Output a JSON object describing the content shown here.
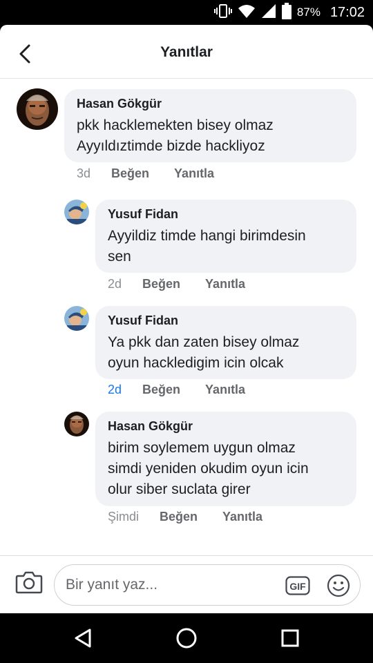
{
  "status_bar": {
    "battery_percent": "87%",
    "time": "17:02",
    "icons": [
      "vibrate-icon",
      "wifi-icon",
      "signal-icon",
      "battery-icon"
    ]
  },
  "header": {
    "title": "Yanıtlar",
    "back_icon": "back-arrow-icon"
  },
  "comments": [
    {
      "author": "Hasan Gökgür",
      "lines": [
        "pkk hacklemekten bisey olmaz",
        "Ayyıldıztimde bizde hackliyoz"
      ],
      "time": "3d",
      "like": "Beğen",
      "reply": "Yanıtla"
    },
    {
      "author": "Yusuf Fidan",
      "lines": [
        "Ayyildiz timde hangi birimdesin",
        "sen"
      ],
      "time": "2d",
      "like": "Beğen",
      "reply": "Yanıtla"
    },
    {
      "author": "Yusuf Fidan",
      "lines": [
        "Ya pkk dan zaten bisey olmaz",
        "oyun hackledigim icin olcak"
      ],
      "time": "2d",
      "like": "Beğen",
      "reply": "Yanıtla"
    },
    {
      "author": "Hasan Gökgür",
      "lines": [
        "birim soylemem uygun olmaz",
        "simdi yeniden okudim oyun icin",
        "olur siber suclata girer"
      ],
      "time": "Şimdi",
      "like": "Beğen",
      "reply": "Yanıtla"
    }
  ],
  "composer": {
    "placeholder": "Bir yanıt yaz...",
    "gif_label": "GIF",
    "icons": [
      "camera-icon",
      "gif-icon",
      "emoji-icon"
    ]
  },
  "nav_bar": {
    "icons": [
      "back-triangle-icon",
      "home-circle-icon",
      "recents-square-icon"
    ]
  },
  "colors": {
    "bubble": "#f0f2f5",
    "text": "#1c1e21",
    "meta": "#65676b",
    "link_blue": "#1877f2"
  }
}
